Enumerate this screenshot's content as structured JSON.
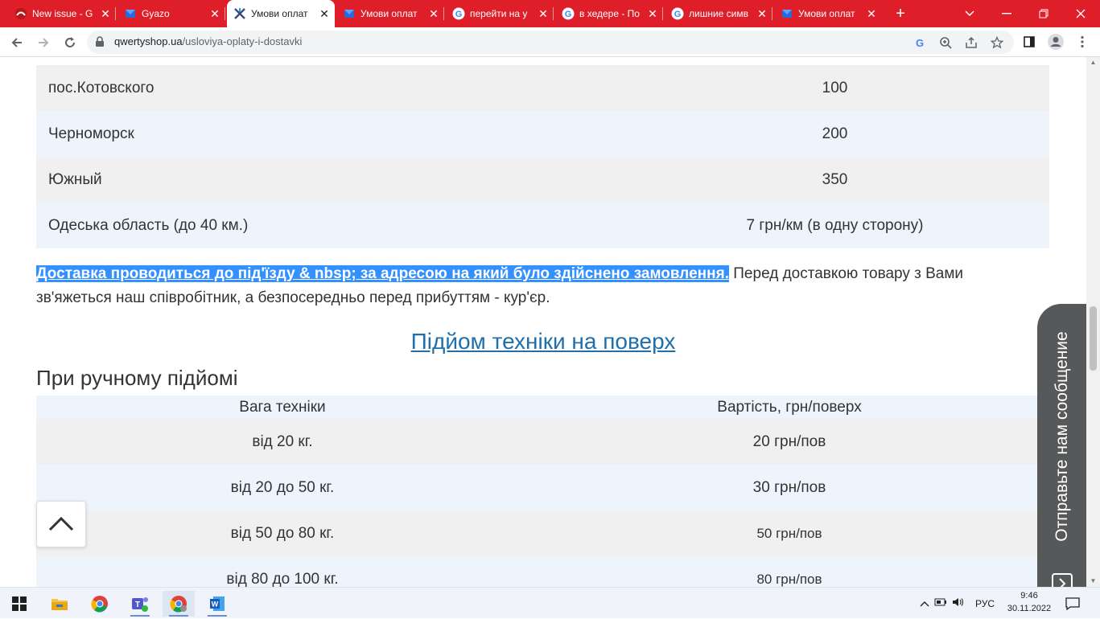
{
  "browser": {
    "tabs": [
      {
        "title": "New issue - G",
        "icon": "github-octocat-icon",
        "active": false
      },
      {
        "title": "Gyazo",
        "icon": "gyazo-icon",
        "active": false
      },
      {
        "title": "Умови оплат",
        "icon": "site-logo-icon",
        "active": true
      },
      {
        "title": "Умови оплат",
        "icon": "gyazo-icon",
        "active": false
      },
      {
        "title": "перейти на у",
        "icon": "google-icon",
        "active": false
      },
      {
        "title": "в хедере - По",
        "icon": "google-icon",
        "active": false
      },
      {
        "title": "лишние симв",
        "icon": "google-icon",
        "active": false
      },
      {
        "title": "Умови оплат",
        "icon": "gyazo-icon",
        "active": false
      }
    ],
    "close_glyph": "✕",
    "new_tab_glyph": "+",
    "url_host": "qwertyshop.ua",
    "url_path": "/usloviya-oplaty-i-dostavki",
    "accent": "#de1f29"
  },
  "delivery_table": {
    "rows": [
      {
        "place": "пос.Котовского",
        "price": "100"
      },
      {
        "place": "Черноморск",
        "price": "200"
      },
      {
        "place": "Южный",
        "price": "350"
      },
      {
        "place": "Одеська область (до 40 км.)",
        "price": "7 грн/км (в одну сторону)"
      }
    ]
  },
  "notice": {
    "highlighted": "Доставка проводиться до під'їзду & nbsp; за адресою на який було здійснено замовлення.",
    "rest": " Перед доставкою товару з Вами зв'яжеться наш співробітник, а безпосередньо перед прибуттям - кур'єр."
  },
  "lift_section": {
    "link_title": "Підйом техніки на поверх",
    "subheading": "При ручному підйомі",
    "headers": [
      "Вага техніки",
      "Вартість, грн/поверх"
    ],
    "rows": [
      {
        "weight": "від 20 кг.",
        "cost": "20 грн/пов"
      },
      {
        "weight": "від 20 до 50 кг.",
        "cost": "30 грн/пов"
      },
      {
        "weight": "від 50 до 80 кг.",
        "cost": "50 грн/пов"
      },
      {
        "weight": "від 80 до 100 кг.",
        "cost": "80 грн/пов"
      }
    ]
  },
  "feedback_widget": {
    "label": "Отправьте нам сообщение"
  },
  "taskbar": {
    "apps": [
      "windows-start-icon",
      "file-explorer-icon",
      "chrome-icon",
      "teams-icon",
      "chrome-profile-icon",
      "word-icon"
    ],
    "language": "РУС",
    "time": "9:46",
    "date": "30.11.2022"
  }
}
